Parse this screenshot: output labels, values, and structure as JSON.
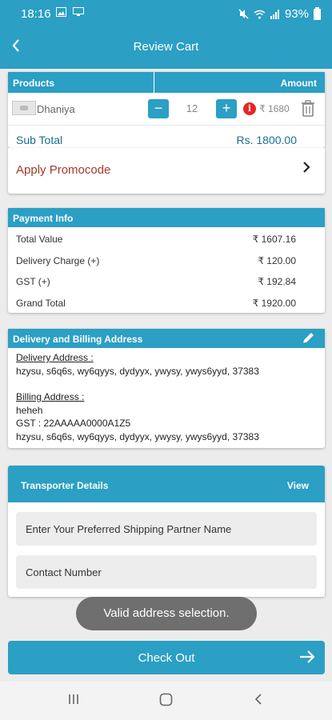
{
  "status_bar": {
    "time": "18:16",
    "left_icons": [
      "image-icon",
      "monitor-icon"
    ],
    "right_icons": [
      "mute-icon",
      "wifi-icon",
      "signal-icon"
    ],
    "battery": "93%"
  },
  "app_bar": {
    "title": "Review Cart"
  },
  "products": {
    "header_left": "Products",
    "header_right": "Amount",
    "items": [
      {
        "name": "Dhaniya",
        "quantity": "12",
        "price": "₹ 1680"
      }
    ],
    "subtotal_label": "Sub Total",
    "subtotal_value": "Rs. 1800.00"
  },
  "promo": {
    "label": "Apply Promocode"
  },
  "payment_info": {
    "title": "Payment Info",
    "rows": [
      {
        "label": "Total Value",
        "value": "₹ 1607.16"
      },
      {
        "label": "Delivery Charge (+)",
        "value": "₹ 120.00"
      },
      {
        "label": "GST (+)",
        "value": "₹ 192.84"
      },
      {
        "label": "Grand Total",
        "value": "₹ 1920.00"
      }
    ]
  },
  "address": {
    "title": "Delivery and Billing Address",
    "delivery_label": "Delivery Address :",
    "delivery_text": "hzysu, s6q6s, wy6qyys, dydyyx, ywysy, ywys6yyd, 37383",
    "billing_label": "Billing Address :",
    "billing_name": "heheh",
    "billing_gst": "GST : 22AAAAA0000A1Z5",
    "billing_text": "hzysu, s6q6s, wy6qyys, dydyyx, ywysy, ywys6yyd, 37383"
  },
  "transporter": {
    "title": "Transporter Details",
    "view_label": "View",
    "shipping_partner_placeholder": "Enter Your Preferred Shipping Partner Name",
    "contact_placeholder": "Contact Number"
  },
  "toast": {
    "message": "Valid address selection."
  },
  "checkout": {
    "label": "Check Out"
  },
  "colors": {
    "primary": "#2b9fc4",
    "danger": "#e82424",
    "promo_text": "#a23b2a"
  }
}
